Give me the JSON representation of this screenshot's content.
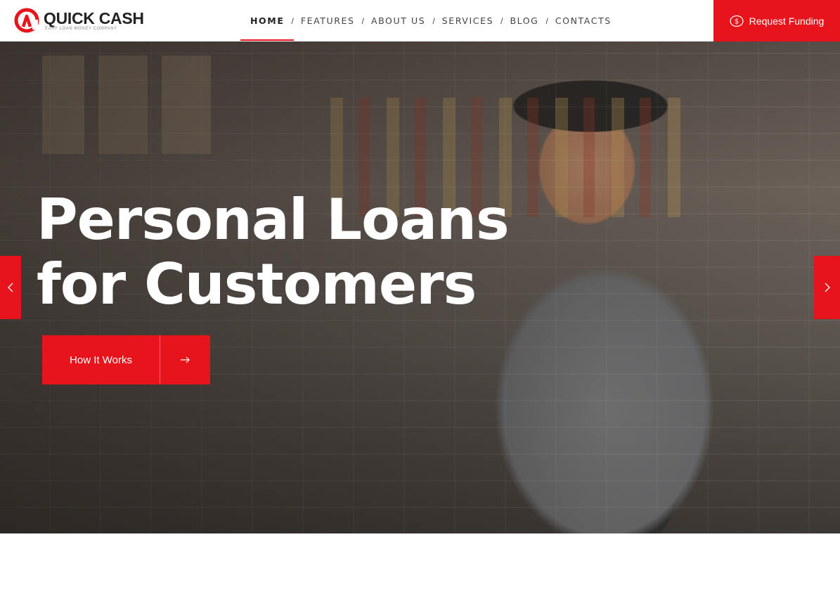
{
  "brand": {
    "name_part1": "QUICK",
    "name_part2": " CASH",
    "tagline": "EASY LOAN MONEY COMPANY",
    "accent_color": "#e8141b"
  },
  "nav": {
    "items": [
      {
        "label": "HOME",
        "active": true
      },
      {
        "label": "FEATURES",
        "active": false
      },
      {
        "label": "ABOUT US",
        "active": false
      },
      {
        "label": "SERVICES",
        "active": false
      },
      {
        "label": "BLOG",
        "active": false
      },
      {
        "label": "CONTACTS",
        "active": false
      }
    ],
    "separator": "/"
  },
  "cta": {
    "label": "Request Funding",
    "icon": "dollar-circle-icon"
  },
  "hero": {
    "headline_line1": "Personal Loans",
    "headline_line2": "for Customers",
    "button_label": "How It Works",
    "button_icon": "arrow-right-icon",
    "prev_icon": "chevron-left-icon",
    "next_icon": "chevron-right-icon"
  }
}
